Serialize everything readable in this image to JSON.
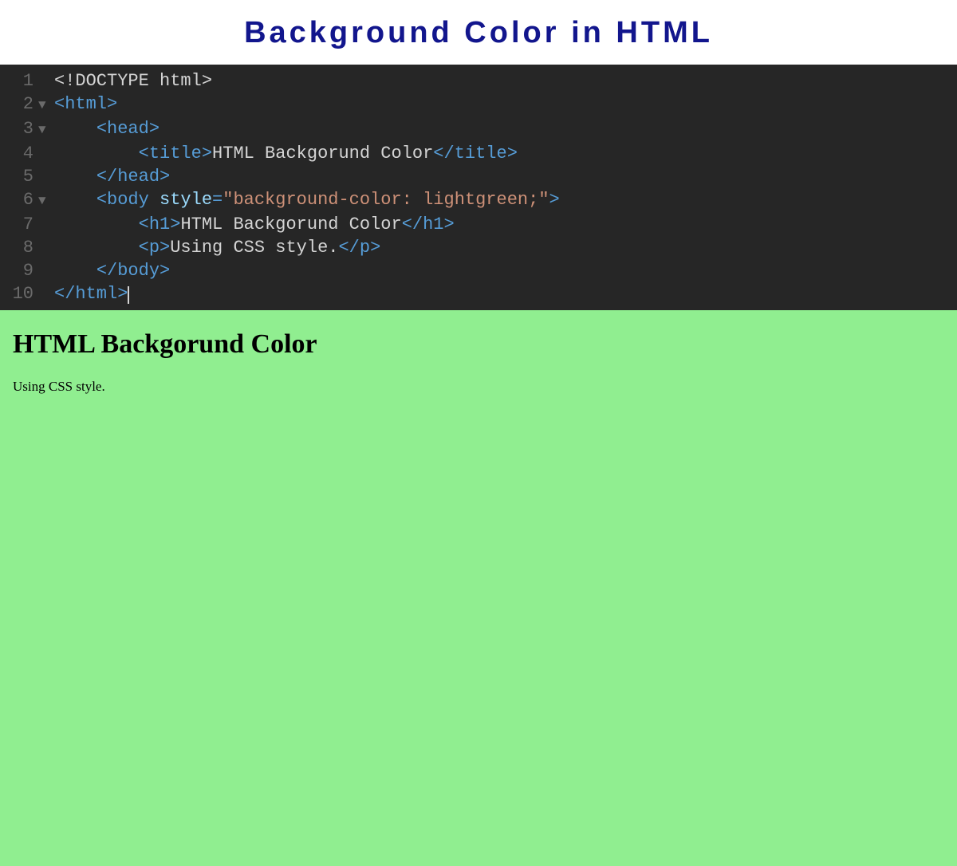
{
  "header": {
    "title": "Background Color in HTML"
  },
  "editor": {
    "lines": [
      {
        "num": "1",
        "fold": "",
        "indent": "",
        "tokens": [
          {
            "t": "txt",
            "v": "<!DOCTYPE html>"
          }
        ]
      },
      {
        "num": "2",
        "fold": "▼",
        "indent": "",
        "tokens": [
          {
            "t": "tag",
            "v": "<html>"
          }
        ]
      },
      {
        "num": "3",
        "fold": "▼",
        "indent": "    ",
        "tokens": [
          {
            "t": "tag",
            "v": "<head>"
          }
        ]
      },
      {
        "num": "4",
        "fold": "",
        "indent": "        ",
        "tokens": [
          {
            "t": "tag",
            "v": "<title>"
          },
          {
            "t": "txt",
            "v": "HTML Backgorund Color"
          },
          {
            "t": "tag",
            "v": "</title>"
          }
        ]
      },
      {
        "num": "5",
        "fold": "",
        "indent": "    ",
        "tokens": [
          {
            "t": "tag",
            "v": "</head>"
          }
        ]
      },
      {
        "num": "6",
        "fold": "▼",
        "indent": "    ",
        "tokens": [
          {
            "t": "tag",
            "v": "<body "
          },
          {
            "t": "attr",
            "v": "style"
          },
          {
            "t": "tag",
            "v": "="
          },
          {
            "t": "str",
            "v": "\"background-color: lightgreen;\""
          },
          {
            "t": "tag",
            "v": ">"
          }
        ]
      },
      {
        "num": "7",
        "fold": "",
        "indent": "        ",
        "tokens": [
          {
            "t": "tag",
            "v": "<h1>"
          },
          {
            "t": "txt",
            "v": "HTML Backgorund Color"
          },
          {
            "t": "tag",
            "v": "</h1>"
          }
        ]
      },
      {
        "num": "8",
        "fold": "",
        "indent": "        ",
        "tokens": [
          {
            "t": "tag",
            "v": "<p>"
          },
          {
            "t": "txt",
            "v": "Using CSS style."
          },
          {
            "t": "tag",
            "v": "</p>"
          }
        ]
      },
      {
        "num": "9",
        "fold": "",
        "indent": "    ",
        "tokens": [
          {
            "t": "tag",
            "v": "</body>"
          }
        ]
      },
      {
        "num": "10",
        "fold": "",
        "indent": "",
        "tokens": [
          {
            "t": "tag",
            "v": "</html>"
          }
        ],
        "cursor": true
      }
    ]
  },
  "preview": {
    "heading": "HTML Backgorund Color",
    "paragraph": "Using CSS style."
  }
}
